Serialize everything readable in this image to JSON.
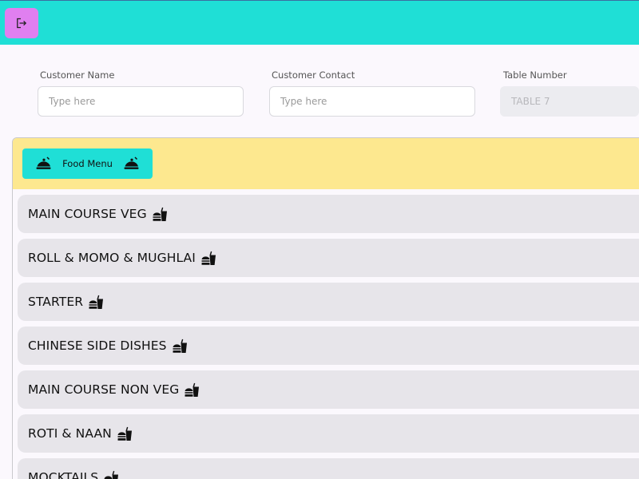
{
  "form": {
    "customer_name": {
      "label": "Customer Name",
      "placeholder": "Type here"
    },
    "customer_contact": {
      "label": "Customer Contact",
      "placeholder": "Type here"
    },
    "table_number": {
      "label": "Table Number",
      "value": "TABLE 7"
    }
  },
  "menu": {
    "button_label": "Food Menu",
    "categories": [
      {
        "label": "MAIN COURSE VEG"
      },
      {
        "label": "ROLL & MOMO & MUGHLAI"
      },
      {
        "label": "STARTER"
      },
      {
        "label": "CHINESE SIDE DISHES"
      },
      {
        "label": "MAIN COURSE NON VEG"
      },
      {
        "label": "ROTI & NAAN"
      },
      {
        "label": "MOCKTAILS"
      }
    ]
  },
  "colors": {
    "topbar": "#1fdfd6",
    "logout_button": "#e07ff0",
    "menu_header": "#fde88f",
    "category_bg": "#e7e5ea"
  },
  "icons": {
    "logout": "logout-icon",
    "food_menu": "food-cover-icon",
    "category": "fastfood-icon"
  }
}
